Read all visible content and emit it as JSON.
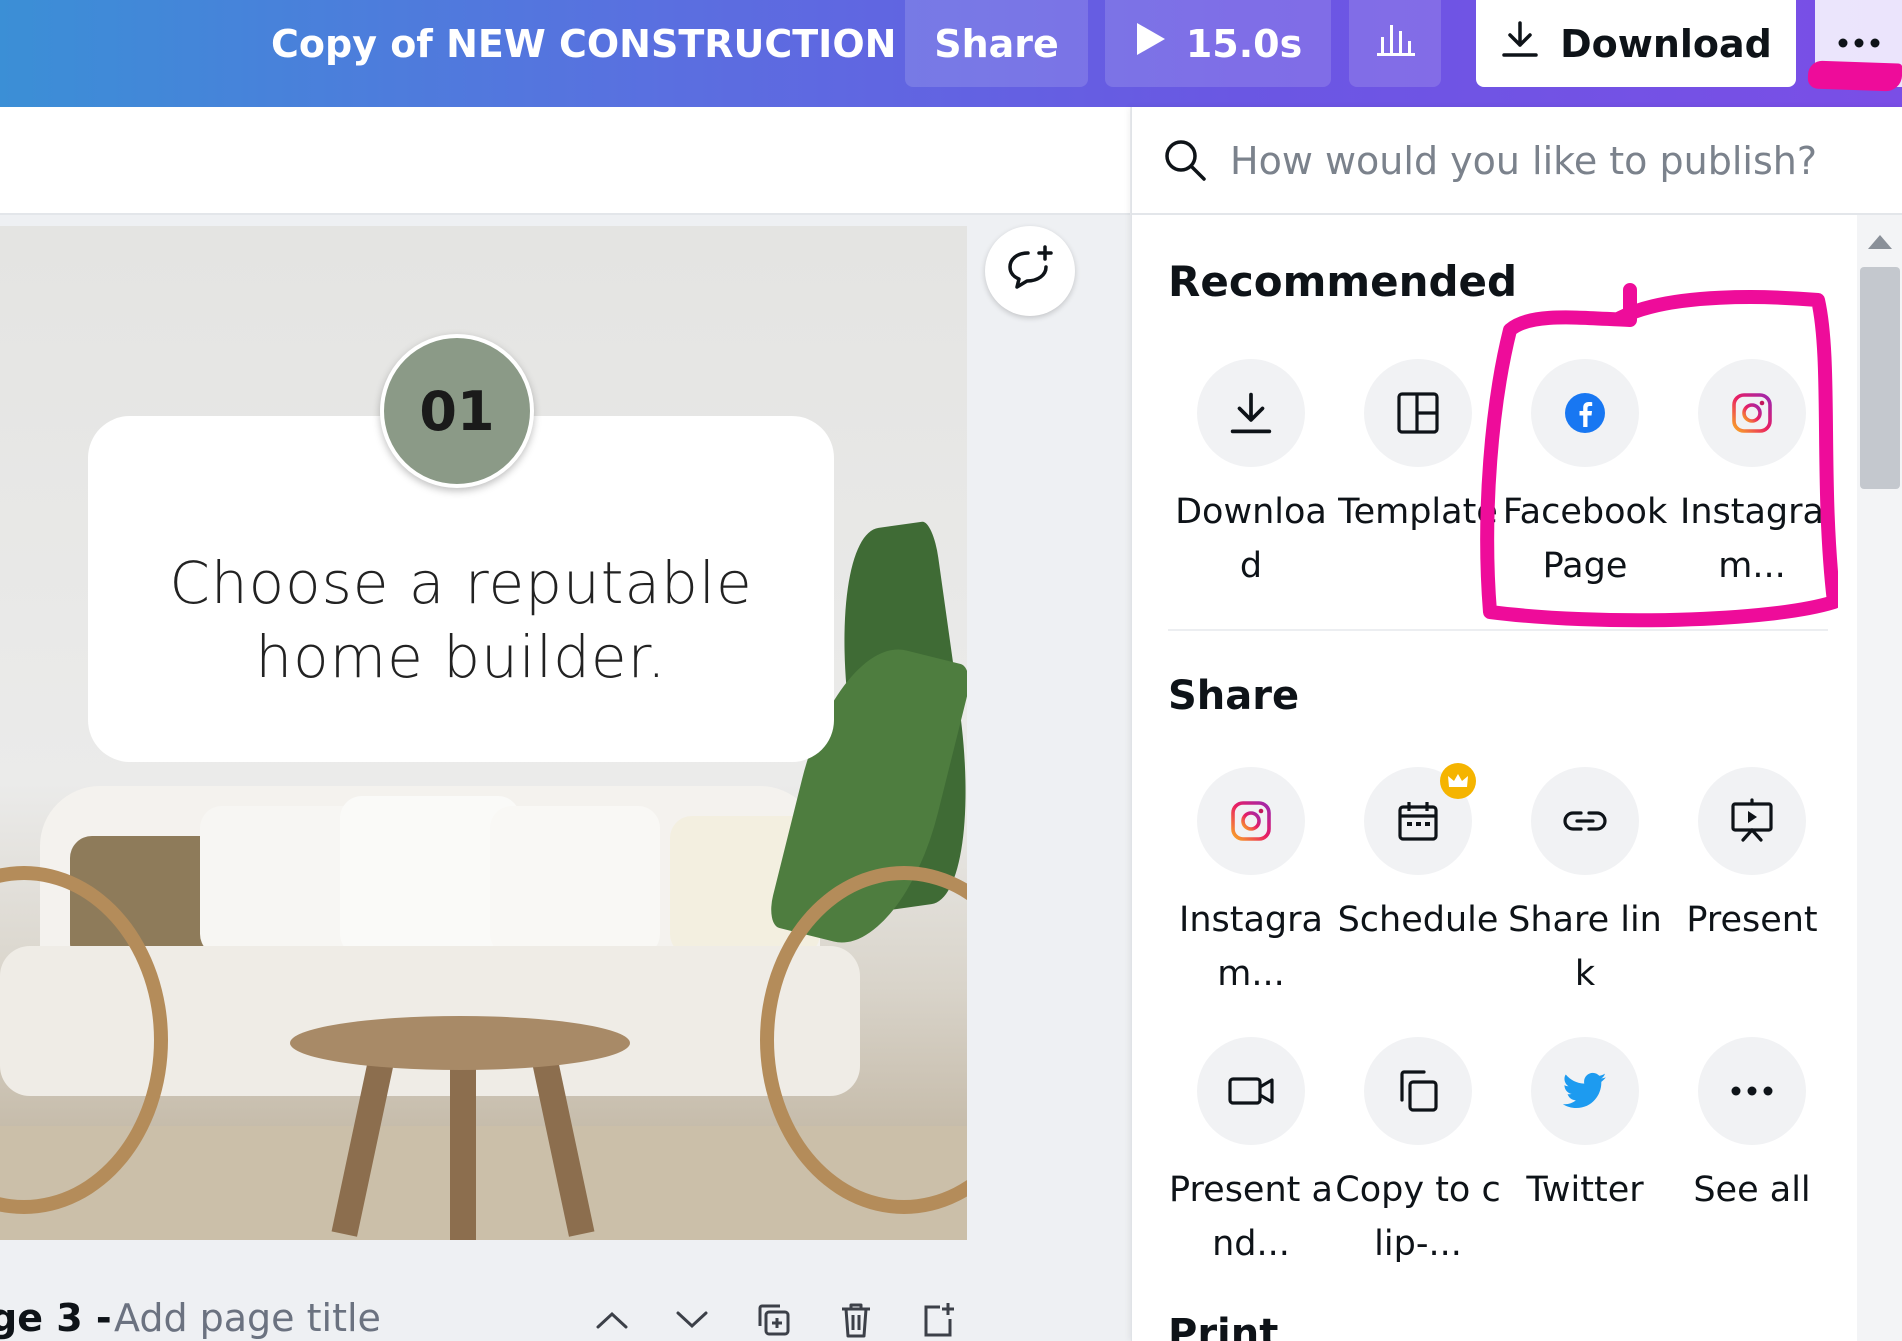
{
  "topbar": {
    "document_title": "Copy of NEW CONSTRUCTION",
    "share_label": "Share",
    "play_duration": "15.0s",
    "download_label": "Download",
    "accent_gradient": [
      "#3b8fd6",
      "#6a57e3",
      "#7a4ee6"
    ]
  },
  "canvas": {
    "badge_number": "01",
    "card_text": "Choose a reputable home builder.",
    "badge_color": "#8b9a87"
  },
  "page_footer": {
    "page_label": "ge 3 -",
    "title_placeholder": "Add page title"
  },
  "publish_panel": {
    "search_placeholder": "How would you like to publish?",
    "recommended": {
      "title": "Recommended",
      "items": [
        {
          "label": "Download",
          "icon": "download-icon"
        },
        {
          "label": "Template",
          "icon": "template-icon"
        },
        {
          "label": "Facebook Page",
          "icon": "facebook-icon"
        },
        {
          "label": "Instagram...",
          "icon": "instagram-icon"
        }
      ]
    },
    "share": {
      "title": "Share",
      "items": [
        {
          "label": "Instagram...",
          "icon": "instagram-icon"
        },
        {
          "label": "Schedule",
          "icon": "calendar-icon",
          "badge": "crown-icon"
        },
        {
          "label": "Share link",
          "icon": "link-icon"
        },
        {
          "label": "Present",
          "icon": "present-icon"
        },
        {
          "label": "Present and...",
          "icon": "video-camera-icon"
        },
        {
          "label": "Copy to clip-...",
          "icon": "copy-icon"
        },
        {
          "label": "Twitter",
          "icon": "twitter-icon"
        },
        {
          "label": "See all",
          "icon": "more-dots-icon"
        }
      ]
    },
    "print": {
      "title": "Print"
    },
    "annotation_color": "#ee0c9a"
  }
}
